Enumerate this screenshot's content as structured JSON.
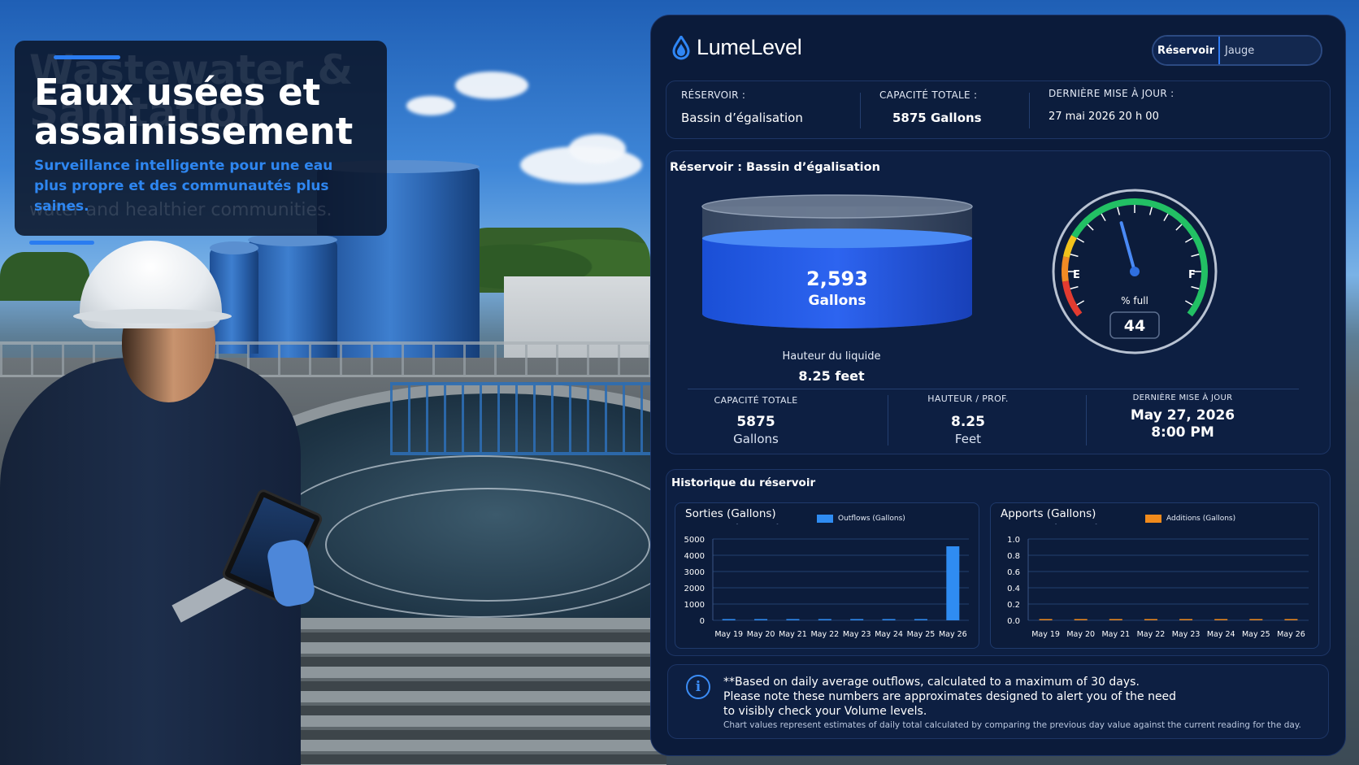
{
  "caption": {
    "ghost_title": "Wastewater & Sanitation",
    "ghost_sub": "water and healthier communities.",
    "title": "Eaux usées et assainissement",
    "subtitle": "Surveillance intelligente pour une eau plus propre et des communautés plus saines."
  },
  "app": {
    "name": "LumeLevel",
    "view_toggle": {
      "options": [
        "Réservoir",
        "Jauge"
      ],
      "selected": "Réservoir"
    }
  },
  "infobar": {
    "reservoir_label": "RÉSERVOIR :",
    "reservoir_value": "Bassin d’égalisation",
    "capacity_label": "CAPACITÉ TOTALE :",
    "capacity_value": "5875 Gallons",
    "updated_label": "DERNIÈRE MISE À JOUR :",
    "updated_value": "27 mai 2026 20 h 00"
  },
  "tank_card": {
    "title": "Réservoir : Bassin d’égalisation",
    "volume_value": "2,593",
    "volume_unit": "Gallons",
    "fill_fraction": 0.44,
    "liquid_height_label": "Hauteur du liquide",
    "liquid_height_value": "8.25 feet",
    "gauge": {
      "empty_label": "E",
      "full_label": "F",
      "caption": "% full",
      "value": "44",
      "percent": 44,
      "colors": [
        "#e23b30",
        "#f08a24",
        "#f2c21b",
        "#22c064"
      ]
    },
    "stats": [
      {
        "label": "CAPACITÉ TOTALE",
        "value": "5875",
        "unit": "Gallons"
      },
      {
        "label": "HAUTEUR / PROF.",
        "value": "8.25",
        "unit": "Feet"
      },
      {
        "label": "DERNIÈRE MISE À JOUR",
        "value": "May 27, 2026",
        "unit": "8:00 PM"
      }
    ]
  },
  "history": {
    "title": "Historique du réservoir",
    "outflow": {
      "title": "Sorties (Gallons)",
      "ghost_title": "Outflows (Gallons)",
      "legend": "Outflows (Gallons)",
      "color": "#2f8cf2"
    },
    "additions": {
      "title": "Apports (Gallons)",
      "ghost_title": "Additions (Gallons)",
      "legend": "Additions (Gallons)",
      "color": "#f08a1c"
    }
  },
  "chart_data": [
    {
      "type": "bar",
      "categories": [
        "May 19",
        "May 20",
        "May 21",
        "May 22",
        "May 23",
        "May 24",
        "May 25",
        "May 26"
      ],
      "series": [
        {
          "name": "Outflows (Gallons)",
          "values": [
            0,
            0,
            0,
            0,
            0,
            0,
            0,
            4550
          ]
        }
      ],
      "ylim": [
        0,
        5000
      ],
      "yticks": [
        0,
        1000,
        2000,
        3000,
        4000,
        5000
      ],
      "grid": true,
      "legend": "top-center"
    },
    {
      "type": "bar",
      "categories": [
        "May 19",
        "May 20",
        "May 21",
        "May 22",
        "May 23",
        "May 24",
        "May 25",
        "May 26"
      ],
      "series": [
        {
          "name": "Additions (Gallons)",
          "values": [
            0,
            0,
            0,
            0,
            0,
            0,
            0,
            0
          ]
        }
      ],
      "ylim": [
        0,
        1.0
      ],
      "yticks": [
        0,
        0.2,
        0.4,
        0.6,
        0.8,
        1.0
      ],
      "grid": true,
      "legend": "top-center"
    }
  ],
  "note": {
    "line1": "**Based on daily average outflows, calculated to a maximum of 30 days.",
    "line2": "Please note these numbers are approximates designed to alert you of the need",
    "line3": "to visibly check your Volume levels.",
    "small": "Chart values represent estimates of daily total calculated by comparing the previous day value against the current reading for the day."
  }
}
